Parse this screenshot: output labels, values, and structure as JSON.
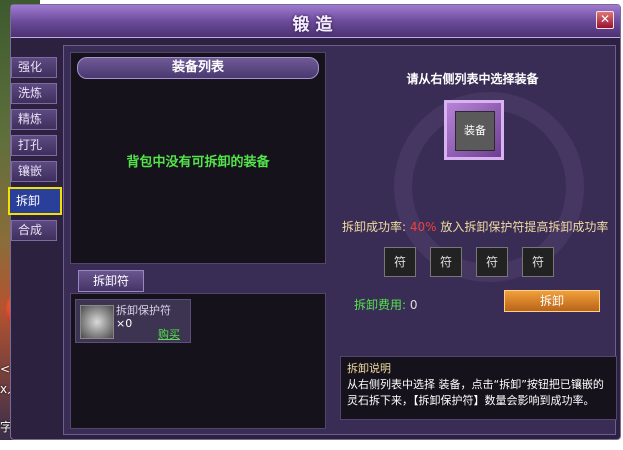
{
  "scene": {
    "text_lines": [
      "<天呢",
      "x人的",
      "字文"
    ]
  },
  "window": {
    "title": "锻造",
    "close_icon": "close-icon"
  },
  "tabs": [
    {
      "label": "强化",
      "active": false
    },
    {
      "label": "洗炼",
      "active": false
    },
    {
      "label": "精炼",
      "active": false
    },
    {
      "label": "打孔",
      "active": false
    },
    {
      "label": "镶嵌",
      "active": false
    },
    {
      "label": "拆卸",
      "active": true
    },
    {
      "label": "合成",
      "active": false
    }
  ],
  "equipment_list": {
    "header": "装备列表",
    "empty_message": "背包中没有可拆卸的装备"
  },
  "rune_tab": {
    "label": "拆卸符"
  },
  "rune_item": {
    "name": "拆卸保护符",
    "count": "×0",
    "buy_label": "购买"
  },
  "right": {
    "hint": "请从右侧列表中选择装备",
    "slot_label": "装备",
    "success_rate_label": "拆卸成功率:",
    "success_rate_value": "40%",
    "success_rate_suffix": "放入拆卸保护符提高拆卸成功率",
    "rune_slots": [
      "符",
      "符",
      "符",
      "符"
    ],
    "cost_label": "拆卸费用:",
    "cost_value": "0",
    "dismantle_button": "拆卸"
  },
  "description": {
    "title": "拆卸说明",
    "text": "从右侧列表中选择 装备，点击“拆卸”按钮把已镶嵌的灵石拆下来，【拆卸保护符】数量会影响到成功率。"
  },
  "colors": {
    "accent_green": "#53e34a",
    "rate_red": "#f04040",
    "active_tab_border": "#f3e100",
    "button_orange": "#f0a03a"
  }
}
